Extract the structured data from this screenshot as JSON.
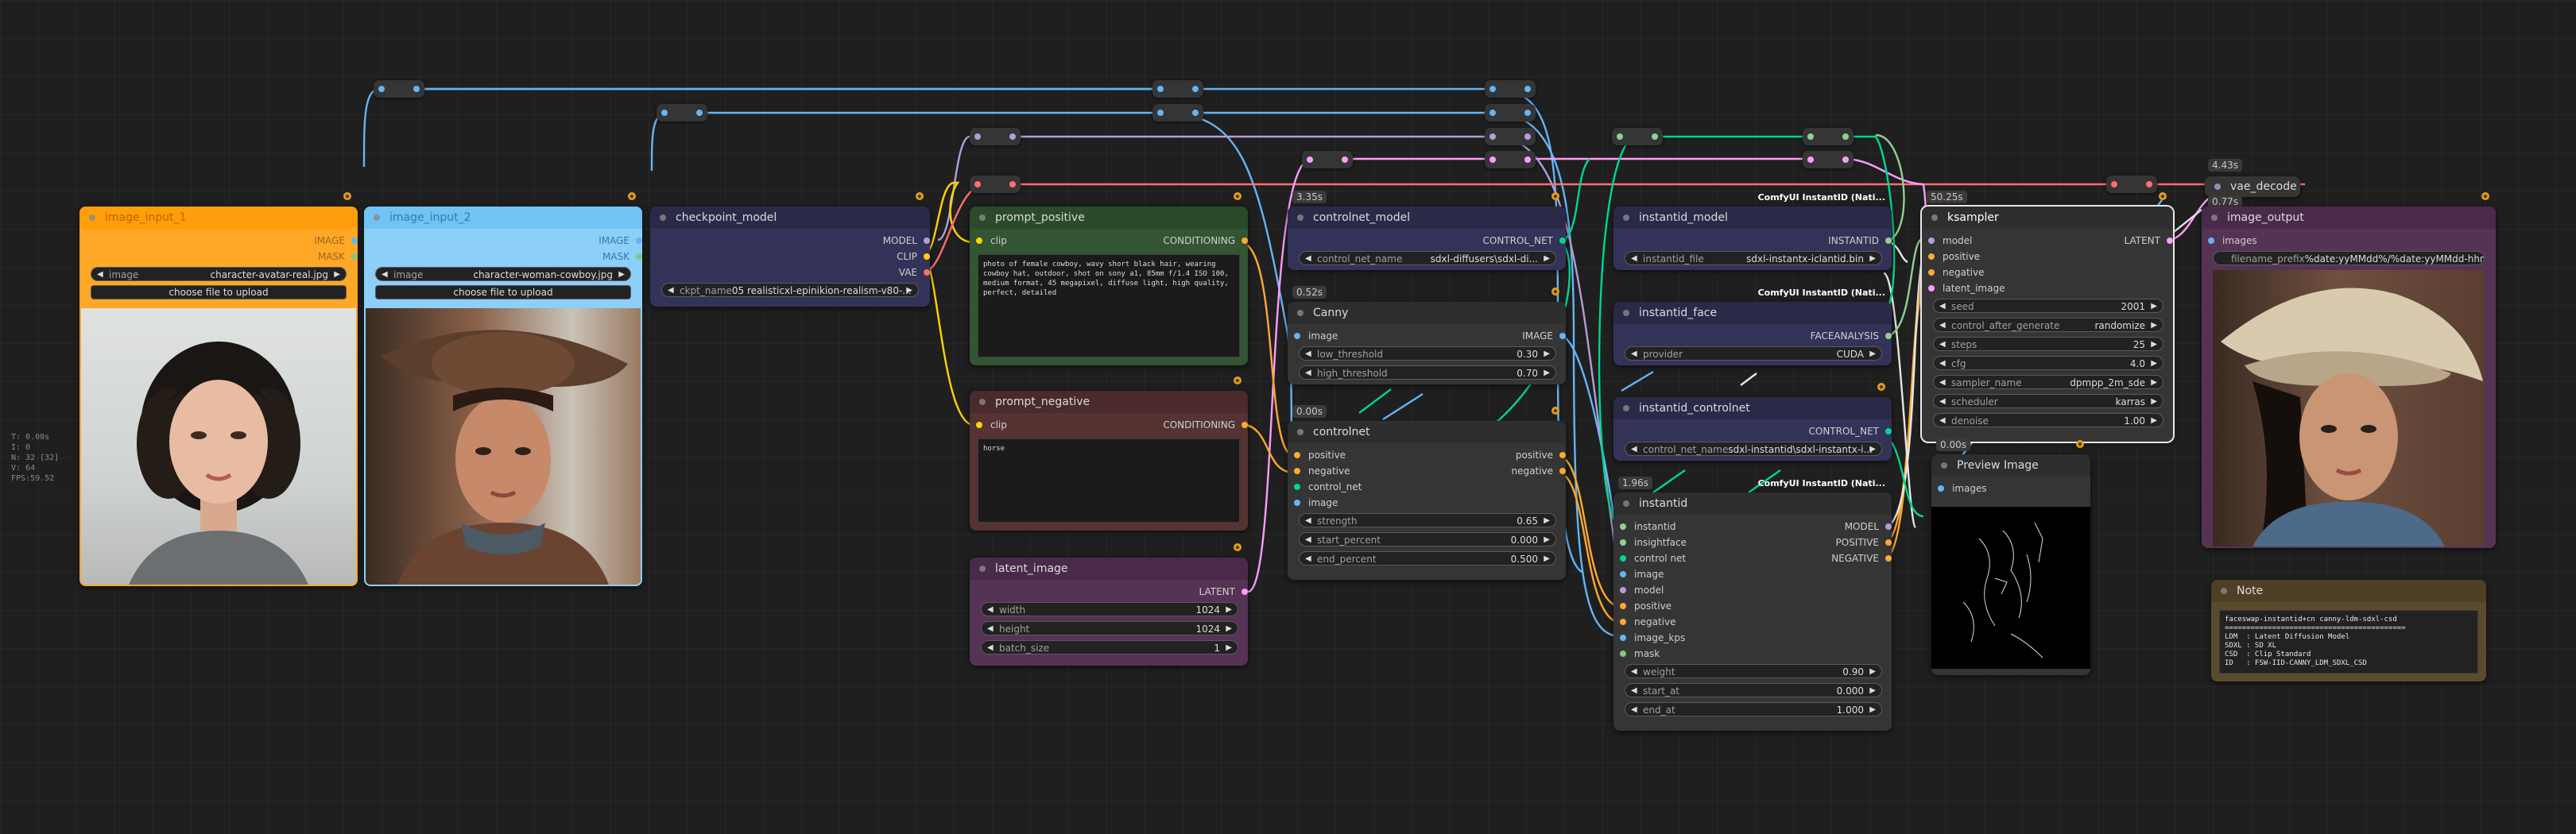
{
  "colors": {
    "model": "#b39ddb",
    "clip": "#ffd500",
    "vae": "#ff6e6e",
    "conditioning": "#ffa931",
    "latent": "#ff9cf9",
    "image": "#64b5f6",
    "control_net": "#00d78d",
    "mask": "#81c784",
    "instantid": "#8fd18f",
    "faceanalysis": "#8fd18f"
  },
  "stats": {
    "line1": "T: 0.00s",
    "line2": "I: 0",
    "line3": "N: 32 [32]",
    "line4": "V: 64",
    "line5": "FPS:59.52"
  },
  "image_input_1": {
    "title": "image_input_1",
    "out_image": "IMAGE",
    "out_mask": "MASK",
    "w_image_label": "image",
    "w_image_value": "character-avatar-real.jpg",
    "upload": "choose file to upload"
  },
  "image_input_2": {
    "title": "image_input_2",
    "out_image": "IMAGE",
    "out_mask": "MASK",
    "w_image_label": "image",
    "w_image_value": "character-woman-cowboy.jpg",
    "upload": "choose file to upload"
  },
  "checkpoint_model": {
    "title": "checkpoint_model",
    "out_model": "MODEL",
    "out_clip": "CLIP",
    "out_vae": "VAE",
    "w_ckpt_label": "ckpt_name",
    "w_ckpt_value": "05 realisticxl-epinikion-realism-v80-..."
  },
  "prompt_positive": {
    "title": "prompt_positive",
    "in_clip": "clip",
    "out": "CONDITIONING",
    "text": "photo of female cowboy, wavy short black hair, wearing cowboy hat, outdoor, shot on sony a1, 85mm f/1.4 ISO 100, medium format, 45 megapixel, diffuse light, high quality, perfect, detailed"
  },
  "prompt_negative": {
    "title": "prompt_negative",
    "in_clip": "clip",
    "out": "CONDITIONING",
    "text": "horse"
  },
  "latent_image": {
    "title": "latent_image",
    "out": "LATENT",
    "w_width_label": "width",
    "w_width_value": "1024",
    "w_height_label": "height",
    "w_height_value": "1024",
    "w_batch_label": "batch_size",
    "w_batch_value": "1"
  },
  "controlnet_model": {
    "title": "controlnet_model",
    "badge": "3.35s",
    "out": "CONTROL_NET",
    "w_label": "control_net_name",
    "w_value": "sdxl-diffusers\\sdxl-di..."
  },
  "canny": {
    "title": "Canny",
    "badge": "0.52s",
    "in_image": "image",
    "out": "IMAGE",
    "w_low_label": "low_threshold",
    "w_low_value": "0.30",
    "w_high_label": "high_threshold",
    "w_high_value": "0.70"
  },
  "controlnet": {
    "title": "controlnet",
    "badge": "0.00s",
    "in_positive": "positive",
    "in_negative": "negative",
    "in_control_net": "control_net",
    "in_image": "image",
    "out_positive": "positive",
    "out_negative": "negative",
    "w_strength_label": "strength",
    "w_strength_value": "0.65",
    "w_start_label": "start_percent",
    "w_start_value": "0.000",
    "w_end_label": "end_percent",
    "w_end_value": "0.500"
  },
  "instantid_model": {
    "title": "instantid_model",
    "cid": "ComfyUI InstantID (Nati...",
    "out": "INSTANTID",
    "w_label": "instantid_file",
    "w_value": "sdxl-instantx-iclantid.bin"
  },
  "instantid_face": {
    "title": "instantid_face",
    "cid": "ComfyUI InstantID (Nati...",
    "out": "FACEANALYSIS",
    "w_label": "provider",
    "w_value": "CUDA"
  },
  "instantid_controlnet": {
    "title": "instantid_controlnet",
    "out": "CONTROL_NET",
    "w_label": "control_net_name",
    "w_value": "sdxl-instantid\\sdxl-instantx-i..."
  },
  "instantid": {
    "title": "instantid",
    "badge": "1.96s",
    "cid": "ComfyUI InstantID (Nati...",
    "inputs": [
      "instantid",
      "insightface",
      "control net",
      "image",
      "model",
      "positive",
      "negative",
      "image_kps",
      "mask"
    ],
    "out_model": "MODEL",
    "out_positive": "POSITIVE",
    "out_negative": "NEGATIVE",
    "w_weight_label": "weight",
    "w_weight_value": "0.90",
    "w_start_label": "start_at",
    "w_start_value": "0.000",
    "w_end_label": "end_at",
    "w_end_value": "1.000"
  },
  "ksampler": {
    "title": "ksampler",
    "badge": "50.25s",
    "inputs": [
      "model",
      "positive",
      "negative",
      "latent_image"
    ],
    "out": "LATENT",
    "widgets": [
      {
        "label": "seed",
        "value": "2001"
      },
      {
        "label": "control_after_generate",
        "value": "randomize"
      },
      {
        "label": "steps",
        "value": "25"
      },
      {
        "label": "cfg",
        "value": "4.0"
      },
      {
        "label": "sampler_name",
        "value": "dpmpp_2m_sde"
      },
      {
        "label": "scheduler",
        "value": "karras"
      },
      {
        "label": "denoise",
        "value": "1.00"
      }
    ]
  },
  "vae_decode": {
    "title": "vae_decode",
    "badge": "4.43s",
    "badge2": "0.77s"
  },
  "image_output": {
    "title": "image_output",
    "in_images": "images",
    "w_label": "filename_prefix",
    "w_value": "%date:yyMMdd%/%date:yyMMdd-hhm"
  },
  "preview_image": {
    "title": "Preview Image",
    "badge": "0.00s",
    "in_images": "images"
  },
  "note": {
    "title": "Note",
    "text": "faceswap-instantid+cn canny-ldm-sdxl-csd\n==========================================\nLDM  : Latent Diffusion Model\nSDXL : SD XL\nCSD  : Clip Standard\nID   : FSW-IID-CANNY_LDM_SDXL_CSD"
  }
}
